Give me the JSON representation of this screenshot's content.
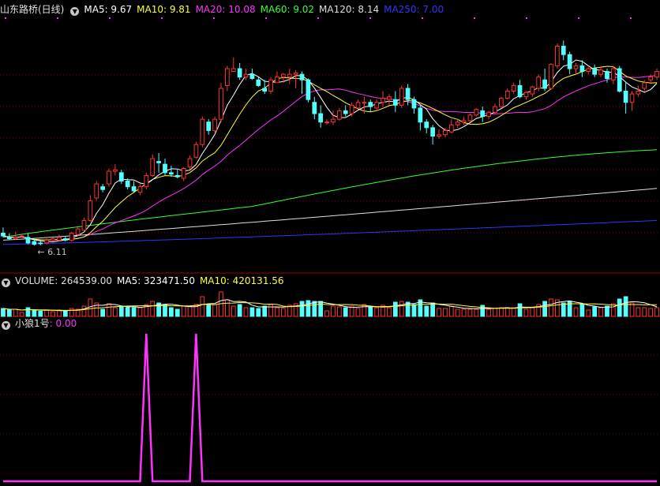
{
  "header": {
    "stock_title": "山东路桥(日线)",
    "ma": [
      {
        "label": "MA5: 9.67",
        "color": "#ffffff"
      },
      {
        "label": "MA10: 9.81",
        "color": "#ffff33"
      },
      {
        "label": "MA20: 10.08",
        "color": "#ff33ff"
      },
      {
        "label": "MA60: 9.02",
        "color": "#33ff33"
      },
      {
        "label": "MA120: 8.14",
        "color": "#dddddd"
      },
      {
        "label": "MA250: 7.00",
        "color": "#3333ff"
      }
    ],
    "min_annotation": "6.11"
  },
  "volume_panel": {
    "label": "VOLUME: 264539.00",
    "ma5": "MA5: 323471.50",
    "ma10": "MA10: 420131.56"
  },
  "indicator_panel": {
    "name": "小狼1号",
    "value": ": 0.00"
  },
  "colors": {
    "up": "#ff3232",
    "down": "#54ffff",
    "grid": "#7a0000",
    "indicator": "#ff33ff"
  },
  "chart_data": {
    "type": "candlestick",
    "ohlc": [
      [
        6.55,
        6.75,
        6.45,
        6.4
      ],
      [
        6.4,
        6.55,
        6.35,
        6.3
      ],
      [
        6.35,
        6.6,
        6.4,
        6.3
      ],
      [
        6.45,
        6.5,
        6.45,
        6.4
      ],
      [
        6.4,
        6.55,
        6.2,
        6.15
      ],
      [
        6.25,
        6.35,
        6.15,
        6.11
      ],
      [
        6.2,
        6.3,
        6.18,
        6.12
      ],
      [
        6.2,
        6.4,
        6.3,
        6.15
      ],
      [
        6.3,
        6.4,
        6.35,
        6.25
      ],
      [
        6.3,
        6.5,
        6.4,
        6.25
      ],
      [
        6.35,
        6.45,
        6.3,
        6.25
      ],
      [
        6.3,
        6.6,
        6.55,
        6.25
      ],
      [
        6.5,
        6.75,
        6.7,
        6.45
      ],
      [
        6.65,
        7.1,
        7.0,
        6.6
      ],
      [
        7.0,
        7.9,
        7.7,
        6.95
      ],
      [
        7.8,
        8.4,
        8.3,
        7.7
      ],
      [
        8.2,
        8.3,
        8.1,
        8.0
      ],
      [
        8.3,
        8.85,
        8.75,
        8.2
      ],
      [
        8.75,
        9.0,
        8.8,
        8.6
      ],
      [
        8.7,
        8.8,
        8.4,
        8.3
      ],
      [
        8.4,
        8.5,
        8.2,
        8.1
      ],
      [
        8.2,
        8.4,
        8.05,
        8.0
      ],
      [
        8.0,
        8.3,
        8.2,
        7.9
      ],
      [
        8.2,
        8.7,
        8.6,
        8.1
      ],
      [
        8.6,
        9.35,
        9.2,
        8.55
      ],
      [
        9.1,
        9.4,
        9.05,
        8.7
      ],
      [
        9.0,
        9.2,
        8.7,
        8.6
      ],
      [
        8.7,
        8.95,
        8.65,
        8.55
      ],
      [
        8.6,
        8.8,
        8.55,
        8.5
      ],
      [
        8.5,
        8.9,
        8.85,
        8.4
      ],
      [
        8.9,
        9.3,
        9.2,
        8.8
      ],
      [
        9.25,
        9.8,
        9.7,
        9.2
      ],
      [
        9.7,
        10.7,
        10.6,
        9.6
      ],
      [
        10.5,
        10.6,
        10.2,
        10.05
      ],
      [
        10.2,
        10.7,
        10.6,
        10.1
      ],
      [
        10.6,
        11.9,
        11.7,
        10.5
      ],
      [
        11.8,
        12.5,
        12.4,
        11.6
      ],
      [
        12.3,
        12.8,
        12.4,
        12.3
      ],
      [
        12.4,
        12.6,
        12.1,
        12.0
      ],
      [
        12.1,
        12.4,
        12.2,
        12.0
      ],
      [
        12.2,
        12.4,
        12.05,
        12.0
      ],
      [
        12.0,
        12.1,
        11.8,
        11.75
      ],
      [
        11.7,
        12.0,
        11.6,
        11.5
      ],
      [
        11.6,
        12.1,
        12.0,
        11.5
      ],
      [
        11.9,
        12.3,
        12.1,
        11.9
      ],
      [
        12.1,
        12.25,
        12.2,
        11.9
      ],
      [
        12.1,
        12.4,
        12.2,
        11.85
      ],
      [
        12.2,
        12.35,
        12.25,
        11.7
      ],
      [
        12.2,
        12.3,
        12.0,
        11.5
      ],
      [
        12.0,
        12.05,
        11.3,
        11.2
      ],
      [
        11.2,
        11.4,
        10.8,
        10.6
      ],
      [
        10.8,
        11.1,
        10.5,
        10.3
      ],
      [
        10.5,
        10.6,
        10.5,
        10.4
      ],
      [
        10.5,
        10.9,
        10.6,
        10.4
      ],
      [
        10.6,
        11.0,
        10.9,
        10.55
      ],
      [
        10.9,
        11.1,
        10.8,
        10.7
      ],
      [
        10.8,
        11.2,
        11.1,
        10.7
      ],
      [
        11.0,
        11.3,
        11.2,
        10.95
      ],
      [
        11.2,
        11.4,
        11.2,
        10.8
      ],
      [
        11.2,
        11.3,
        11.05,
        10.85
      ],
      [
        11.0,
        11.3,
        11.2,
        10.9
      ],
      [
        11.2,
        11.6,
        11.35,
        11.05
      ],
      [
        11.3,
        11.5,
        11.4,
        11.1
      ],
      [
        11.3,
        11.6,
        11.1,
        10.85
      ],
      [
        11.1,
        11.8,
        11.7,
        11.0
      ],
      [
        11.7,
        11.85,
        11.3,
        11.1
      ],
      [
        11.3,
        11.4,
        11.0,
        10.8
      ],
      [
        11.0,
        11.1,
        10.5,
        10.2
      ],
      [
        10.5,
        10.6,
        10.3,
        10.1
      ],
      [
        10.3,
        10.4,
        10.0,
        9.7
      ],
      [
        10.0,
        10.25,
        10.05,
        9.9
      ],
      [
        10.05,
        10.3,
        10.2,
        9.95
      ],
      [
        10.15,
        10.6,
        10.4,
        10.1
      ],
      [
        10.4,
        10.6,
        10.5,
        10.3
      ],
      [
        10.5,
        10.7,
        10.55,
        10.4
      ],
      [
        10.55,
        10.8,
        10.75,
        10.5
      ],
      [
        10.75,
        11.0,
        10.95,
        10.7
      ],
      [
        10.9,
        11.05,
        10.7,
        10.5
      ],
      [
        10.7,
        10.9,
        10.85,
        10.6
      ],
      [
        10.85,
        11.15,
        11.05,
        10.8
      ],
      [
        11.05,
        11.4,
        11.35,
        11.0
      ],
      [
        11.35,
        11.7,
        11.6,
        11.3
      ],
      [
        11.6,
        11.9,
        11.8,
        11.5
      ],
      [
        11.8,
        12.0,
        11.4,
        11.35
      ],
      [
        11.4,
        11.6,
        11.55,
        11.3
      ],
      [
        11.5,
        11.8,
        11.75,
        11.4
      ],
      [
        11.7,
        12.2,
        12.1,
        11.6
      ],
      [
        12.0,
        12.4,
        11.7,
        11.6
      ],
      [
        11.7,
        12.6,
        12.55,
        11.65
      ],
      [
        12.5,
        13.3,
        13.2,
        12.4
      ],
      [
        13.2,
        13.4,
        12.9,
        12.7
      ],
      [
        12.9,
        13.0,
        12.4,
        12.2
      ],
      [
        12.4,
        12.6,
        12.5,
        12.2
      ],
      [
        12.5,
        12.7,
        12.3,
        12.1
      ],
      [
        12.3,
        12.45,
        12.4,
        12.2
      ],
      [
        12.4,
        12.55,
        12.2,
        12.1
      ],
      [
        12.2,
        12.5,
        12.35,
        12.1
      ],
      [
        12.3,
        12.4,
        12.05,
        11.9
      ],
      [
        12.0,
        12.5,
        12.4,
        11.85
      ],
      [
        12.4,
        12.5,
        11.6,
        11.55
      ],
      [
        11.6,
        11.9,
        11.2,
        10.8
      ],
      [
        11.2,
        11.6,
        11.5,
        10.9
      ],
      [
        11.5,
        11.8,
        11.6,
        11.4
      ],
      [
        11.7,
        12.0,
        11.9,
        11.6
      ],
      [
        12.0,
        12.2,
        12.1,
        11.85
      ],
      [
        12.1,
        12.4,
        12.3,
        12.0
      ]
    ],
    "volume_ma5": 323471.5,
    "volume_ma10": 420131.56,
    "indicator": {
      "name": "小狼1号",
      "current": 0.0,
      "signal_bars": [
        23,
        31
      ],
      "signal_value": 1
    }
  }
}
